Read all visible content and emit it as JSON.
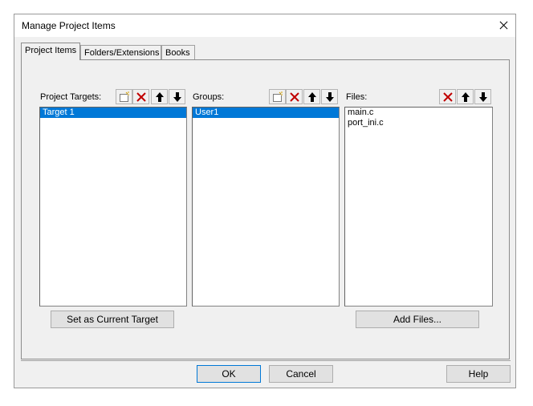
{
  "window": {
    "title": "Manage Project Items"
  },
  "tabs": [
    {
      "label": "Project Items",
      "active": true
    },
    {
      "label": "Folders/Extensions",
      "active": false
    },
    {
      "label": "Books",
      "active": false
    }
  ],
  "panels": {
    "targets": {
      "label": "Project Targets:",
      "items": [
        "Target 1"
      ],
      "selected": 0
    },
    "groups": {
      "label": "Groups:",
      "items": [
        "User1"
      ],
      "selected": 0
    },
    "files": {
      "label": "Files:",
      "items": [
        "main.c",
        "port_ini.c"
      ],
      "selected": -1
    }
  },
  "buttons": {
    "set_current_target": "Set as Current Target",
    "add_files": "Add Files...",
    "ok": "OK",
    "cancel": "Cancel",
    "help": "Help"
  },
  "icons": {
    "new": "new-item-icon",
    "delete": "delete-icon",
    "up": "move-up-icon",
    "down": "move-down-icon",
    "close": "close-icon"
  },
  "colors": {
    "selection": "#0078d7",
    "delete_red": "#c00000",
    "dialog_bg": "#f0f0f0"
  }
}
